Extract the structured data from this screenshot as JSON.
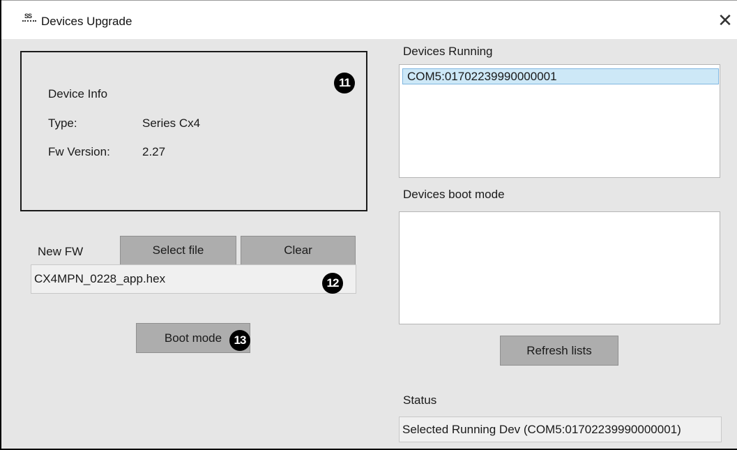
{
  "window": {
    "title": "Devices Upgrade",
    "close_symbol": "✕",
    "app_icon_glyph": "SS"
  },
  "device_info": {
    "title": "Device Info",
    "type_label": "Type:",
    "type_value": "Series Cx4",
    "fw_label": "Fw Version:",
    "fw_value": "2.27"
  },
  "firmware": {
    "label": "New FW",
    "select_label": "Select file",
    "clear_label": "Clear",
    "file_name": "CX4MPN_0228_app.hex"
  },
  "boot_button_label": "Boot mode",
  "markers": [
    "11",
    "12",
    "13"
  ],
  "running": {
    "label": "Devices Running",
    "items": [
      "COM5:01702239990000001"
    ]
  },
  "boot_list": {
    "label": "Devices boot mode",
    "items": []
  },
  "refresh_label": "Refresh lists",
  "status": {
    "label": "Status",
    "value": "Selected Running Dev (COM5:01702239990000001)"
  },
  "colors": {
    "client_bg": "#e6e6e6",
    "button_bg": "#adadad",
    "selection_bg": "#cde8f7",
    "selection_border": "#7fb6e0"
  },
  "icons": [
    "app-icon",
    "close-icon"
  ]
}
